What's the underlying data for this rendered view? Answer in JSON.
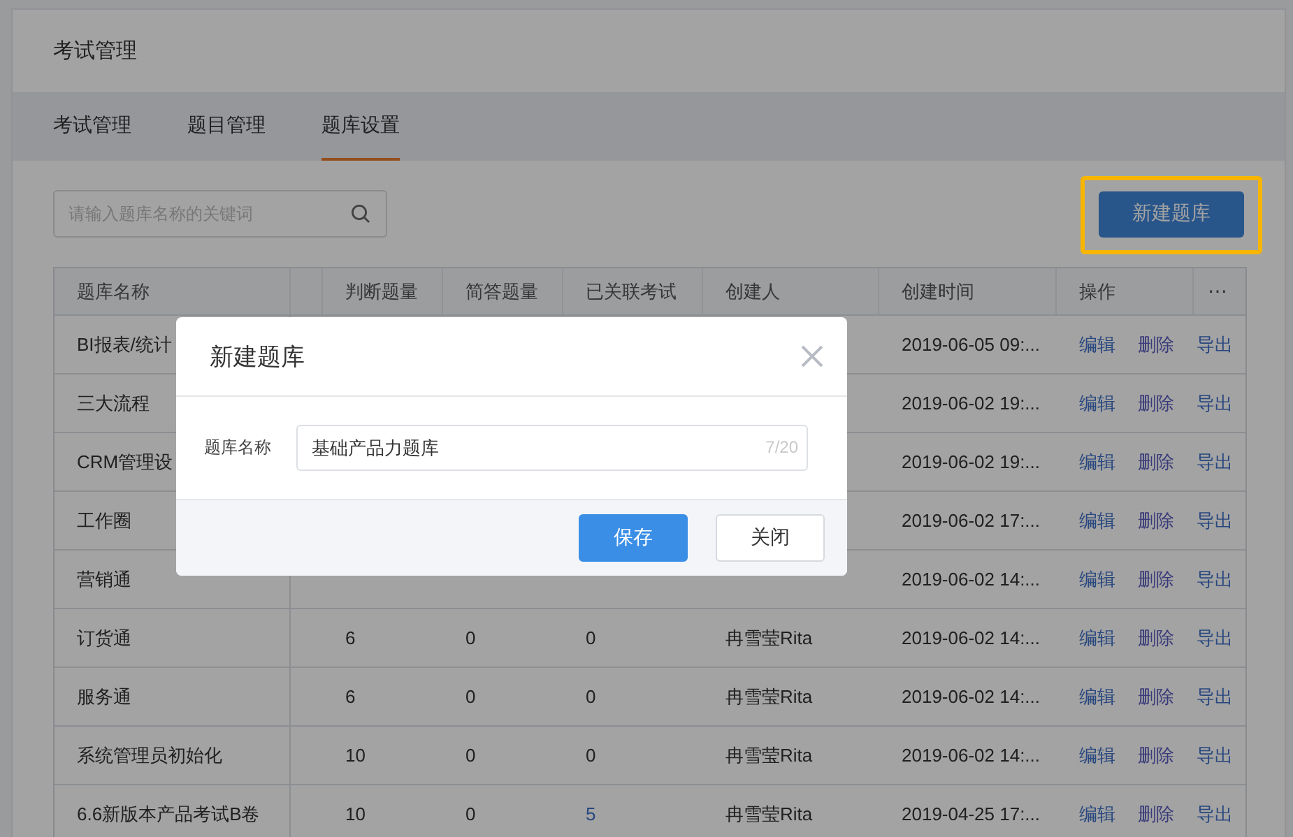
{
  "page_title": "考试管理",
  "tabs": [
    {
      "label": "考试管理",
      "selected": false
    },
    {
      "label": "题目管理",
      "selected": false
    },
    {
      "label": "题库设置",
      "selected": true
    }
  ],
  "search": {
    "placeholder": "请输入题库名称的关键词"
  },
  "new_button": {
    "label": "新建题库",
    "highlighted": true
  },
  "table": {
    "columns": [
      "题库名称",
      "",
      "判断题量",
      "简答题量",
      "已关联考试",
      "创建人",
      "创建时间",
      "操作",
      "⋯"
    ],
    "rows": [
      {
        "name": "BI报表/统计",
        "time": "2019-06-05 09:...",
        "actions": [
          "编辑",
          "删除",
          "导出"
        ]
      },
      {
        "name": "三大流程",
        "time": "2019-06-02 19:...",
        "actions": [
          "编辑",
          "删除",
          "导出"
        ]
      },
      {
        "name": "CRM管理设",
        "time": "2019-06-02 19:...",
        "actions": [
          "编辑",
          "删除",
          "导出"
        ]
      },
      {
        "name": "工作圈",
        "time": "2019-06-02 17:...",
        "actions": [
          "编辑",
          "删除",
          "导出"
        ]
      },
      {
        "name": "营销通",
        "time": "2019-06-02 14:...",
        "actions": [
          "编辑",
          "删除",
          "导出"
        ]
      },
      {
        "name": "订货通",
        "judge": "6",
        "short": "0",
        "linked": "0",
        "linked_is_link": false,
        "creator": "冉雪莹Rita",
        "time": "2019-06-02 14:...",
        "actions": [
          "编辑",
          "删除",
          "导出"
        ]
      },
      {
        "name": "服务通",
        "judge": "6",
        "short": "0",
        "linked": "0",
        "linked_is_link": false,
        "creator": "冉雪莹Rita",
        "time": "2019-06-02 14:...",
        "actions": [
          "编辑",
          "删除",
          "导出"
        ]
      },
      {
        "name": "系统管理员初始化",
        "judge": "10",
        "short": "0",
        "linked": "0",
        "linked_is_link": false,
        "creator": "冉雪莹Rita",
        "time": "2019-06-02 14:...",
        "actions": [
          "编辑",
          "删除",
          "导出"
        ]
      },
      {
        "name": "6.6新版本产品考试B卷",
        "judge": "10",
        "short": "0",
        "linked": "5",
        "linked_is_link": true,
        "creator": "冉雪莹Rita",
        "time": "2019-04-25 17:...",
        "actions": [
          "编辑",
          "删除",
          "导出"
        ]
      }
    ]
  },
  "dialog": {
    "title": "新建题库",
    "field_label": "题库名称",
    "field_value": "基础产品力题库",
    "counter": "7/20",
    "buttons": [
      {
        "label": "保存",
        "kind": "primary"
      },
      {
        "label": "关闭",
        "kind": "default"
      }
    ]
  }
}
